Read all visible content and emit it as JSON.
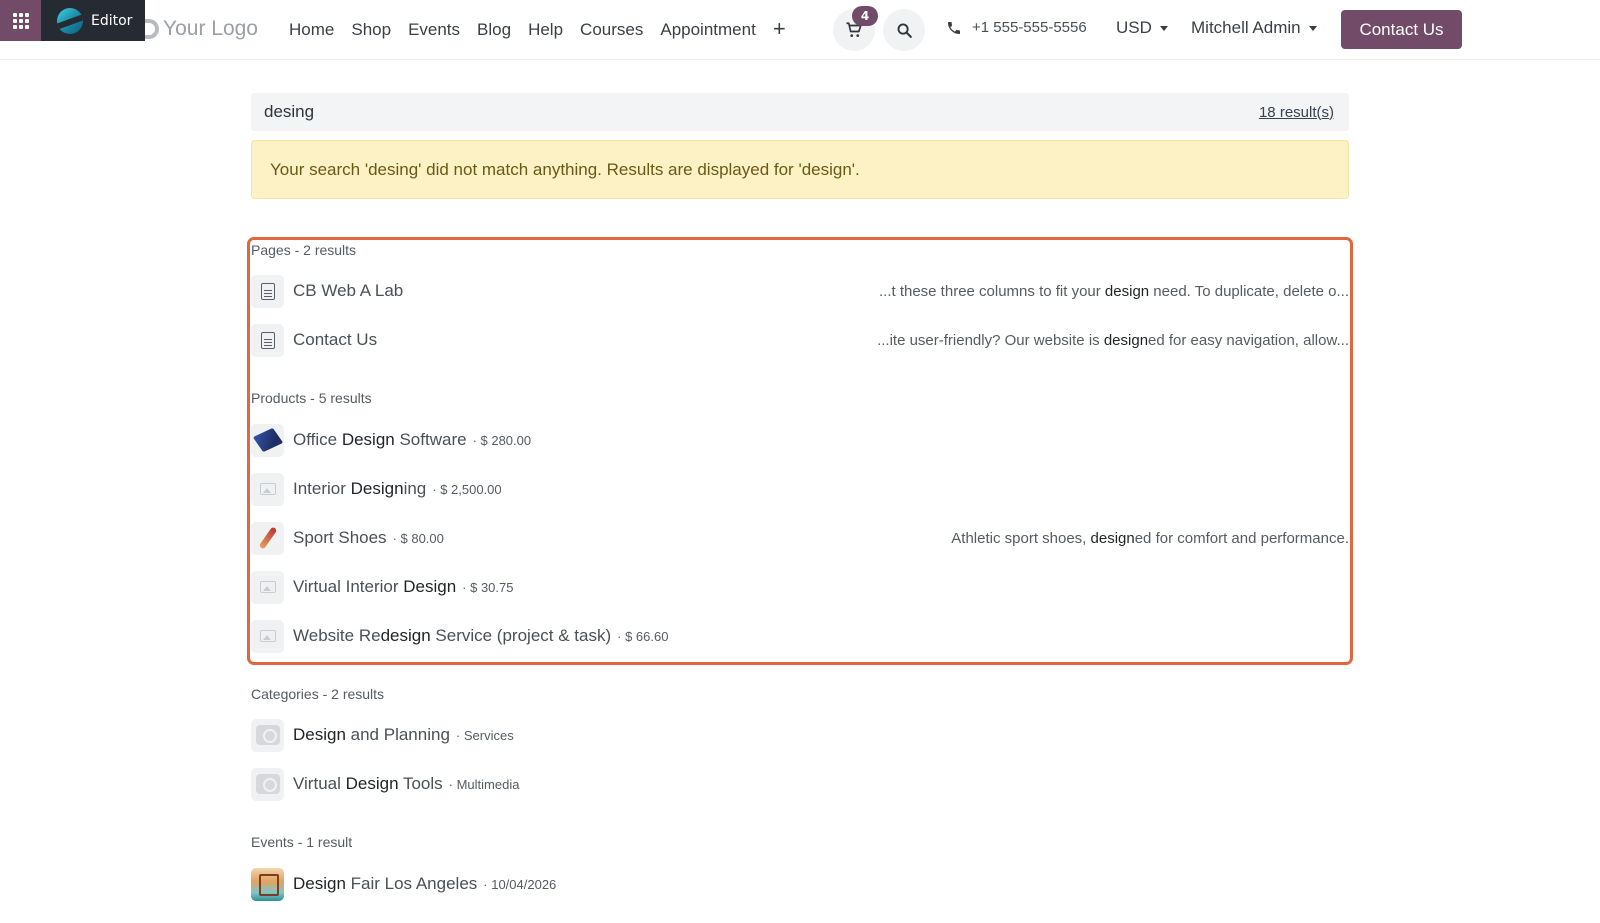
{
  "editor": {
    "label": "Editor"
  },
  "logo": {
    "text": "Your Logo"
  },
  "menu": [
    "Home",
    "Shop",
    "Events",
    "Blog",
    "Help",
    "Courses",
    "Appointment"
  ],
  "menu_add": "+",
  "cart": {
    "count": "4"
  },
  "phone": "+1 555-555-5556",
  "currency": "USD",
  "user": "Mitchell Admin",
  "contact_button": "Contact Us",
  "search": {
    "query": "desing",
    "result_count": "18 result(s)"
  },
  "alert": "Your search 'desing' did not match anything. Results are displayed for 'design'.",
  "groups": {
    "pages": {
      "title": "Pages - 2 results",
      "items": [
        {
          "name": "CB Web A Lab",
          "desc_pre": "...t these three columns to fit your ",
          "desc_hl": "design",
          "desc_post": " need. To duplicate, delete o..."
        },
        {
          "name": "Contact Us",
          "desc_pre": "...ite user-friendly? Our website is ",
          "desc_hl": "design",
          "desc_post": "ed for easy navigation, allow..."
        }
      ]
    },
    "products": {
      "title": "Products - 5 results",
      "items": [
        {
          "pre": "Office ",
          "hl": "Design",
          "post": " Software",
          "price": "· $ 280.00"
        },
        {
          "pre": "Interior ",
          "hl": "Design",
          "post": "ing",
          "price": "· $ 2,500.00"
        },
        {
          "pre": "Sport Shoes",
          "hl": "",
          "post": "",
          "price": "· $ 80.00",
          "desc_pre": "Athletic sport shoes, ",
          "desc_hl": "design",
          "desc_post": "ed for comfort and performance."
        },
        {
          "pre": "Virtual Interior ",
          "hl": "Design",
          "post": "",
          "price": "· $ 30.75"
        },
        {
          "pre": "Website Re",
          "hl": "design",
          "post": " Service (project & task)",
          "price": "· $ 66.60"
        }
      ]
    },
    "categories": {
      "title": "Categories - 2 results",
      "items": [
        {
          "pre": "",
          "hl": "Design",
          "post": " and Planning",
          "extra": "· Services"
        },
        {
          "pre": "Virtual ",
          "hl": "Design",
          "post": " Tools",
          "extra": "· Multimedia"
        }
      ]
    },
    "events": {
      "title": "Events - 1 result",
      "items": [
        {
          "pre": "",
          "hl": "Design",
          "post": " Fair Los Angeles",
          "extra": "· 10/04/2026"
        }
      ]
    }
  },
  "colors": {
    "brand": "#714b67",
    "highlight_border": "#e06841",
    "alert_bg": "#fdf2c5"
  }
}
